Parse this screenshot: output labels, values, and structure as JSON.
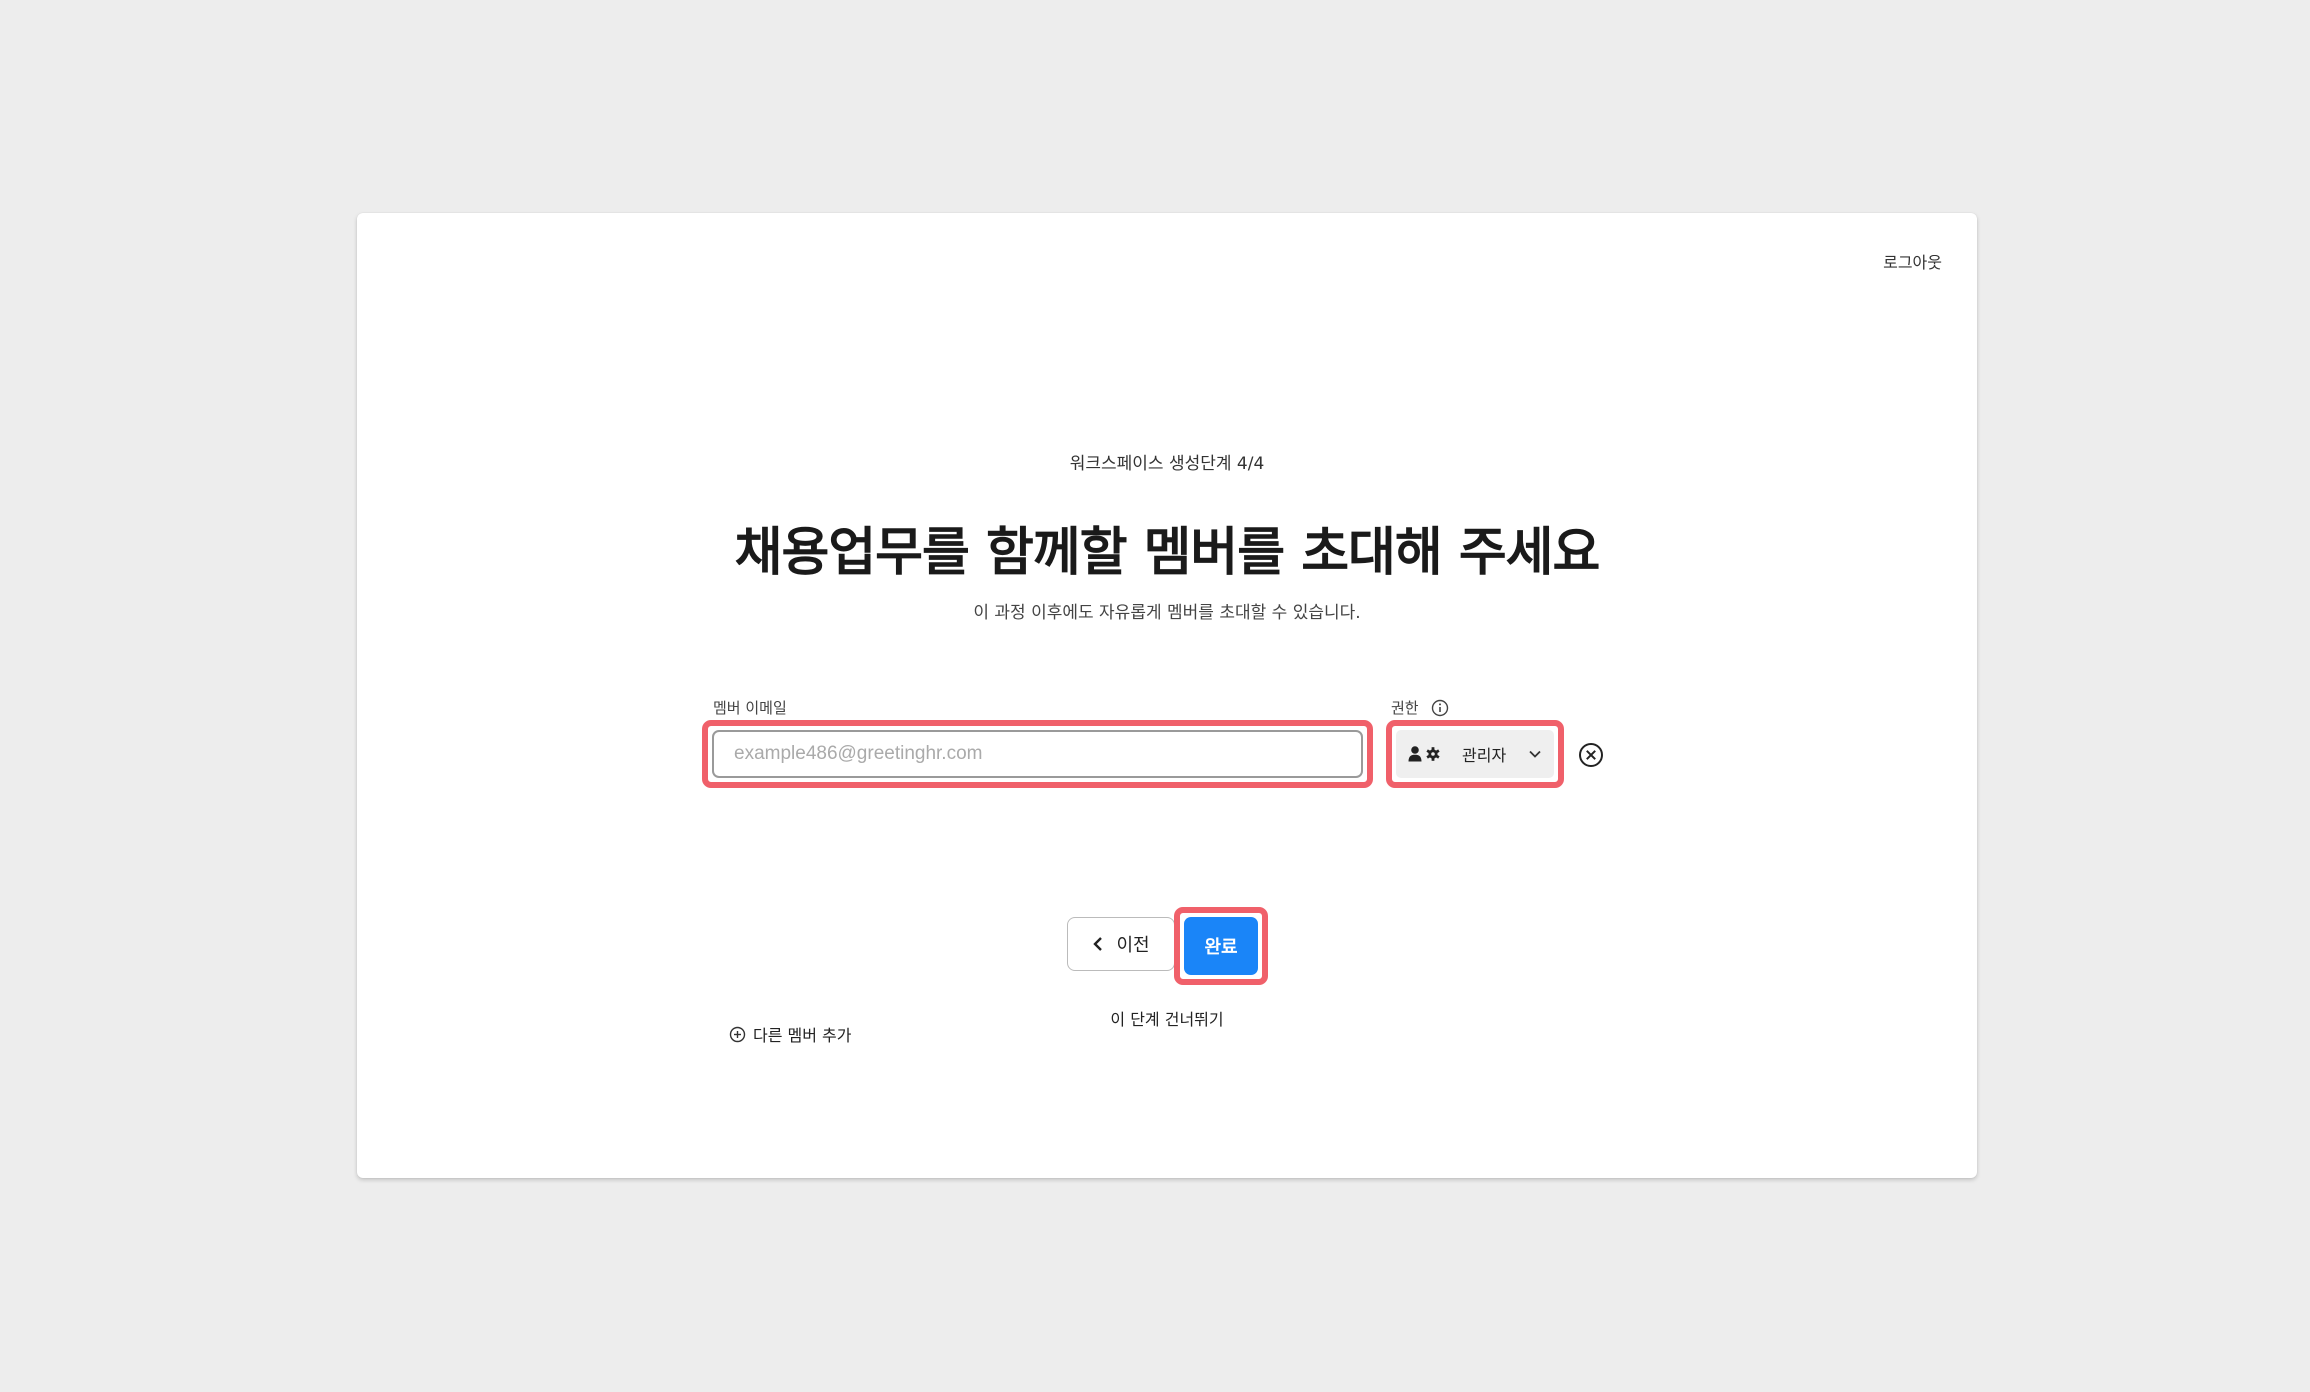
{
  "header": {
    "logout_label": "로그아웃"
  },
  "step": {
    "label": "워크스페이스 생성단계 4/4"
  },
  "title": "채용업무를 함께할 멤버를 초대해 주세요",
  "subtitle": "이 과정 이후에도 자유롭게 멤버를 초대할 수 있습니다.",
  "form": {
    "email_label": "멤버 이메일",
    "email_value": "",
    "email_placeholder": "example486@greetinghr.com",
    "role_label": "권한",
    "role_value": "관리자",
    "add_member_label": "다른 멤버 추가"
  },
  "actions": {
    "prev_label": "이전",
    "done_label": "완료",
    "skip_label": "이 단계 건너뛰기"
  },
  "colors": {
    "accent": "#1a85f8",
    "highlight": "#f0606a",
    "background": "#ededed"
  },
  "icons": {
    "info": "info-circle-icon",
    "role": "user-gear-icon",
    "chevron": "chevron-down-icon",
    "remove": "close-circle-icon",
    "add": "plus-circle-icon",
    "back": "chevron-left-icon"
  }
}
